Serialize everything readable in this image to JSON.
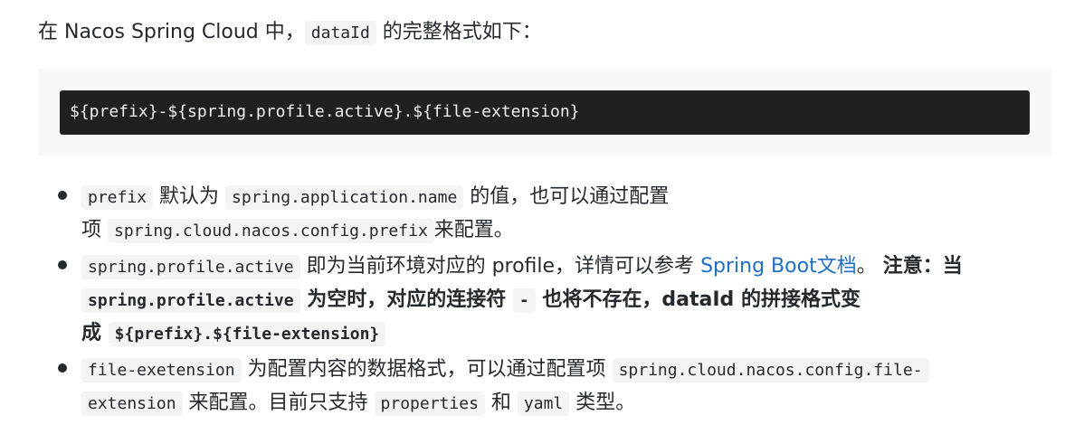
{
  "intro": {
    "before": "在 Nacos Spring Cloud 中，",
    "code": "dataId",
    "after": " 的完整格式如下："
  },
  "code_block": {
    "text": "${prefix}-${spring.profile.active}.${file-extension}"
  },
  "items": [
    {
      "code1": "prefix",
      "text1": " 默认为 ",
      "code2": "spring.application.name",
      "text2": " 的值，也可以通过配置",
      "text3": "项 ",
      "code3": "spring.cloud.nacos.config.prefix",
      "text4": "来配置。"
    },
    {
      "code1": "spring.profile.active",
      "text1": " 即为当前环境对应的 profile，详情可以参考 ",
      "link": "Spring Boot文档",
      "text2": "。 ",
      "strong1": "注意：当",
      "code2": "spring.profile.active",
      "strong2": " 为空时，对应的连接符 ",
      "code3": "-",
      "strong3": " 也将不存在，dataId 的拼接格式变",
      "strong4": "成 ",
      "code4": "${prefix}.${file-extension}"
    },
    {
      "code1": "file-exetension",
      "text1": " 为配置内容的数据格式，可以通过配置项 ",
      "code2": "spring.cloud.nacos.config.file-",
      "code3": "extension",
      "text2": " 来配置。目前只支持 ",
      "code4": "properties",
      "text3": " 和 ",
      "code5": "yaml",
      "text4": " 类型。"
    }
  ]
}
